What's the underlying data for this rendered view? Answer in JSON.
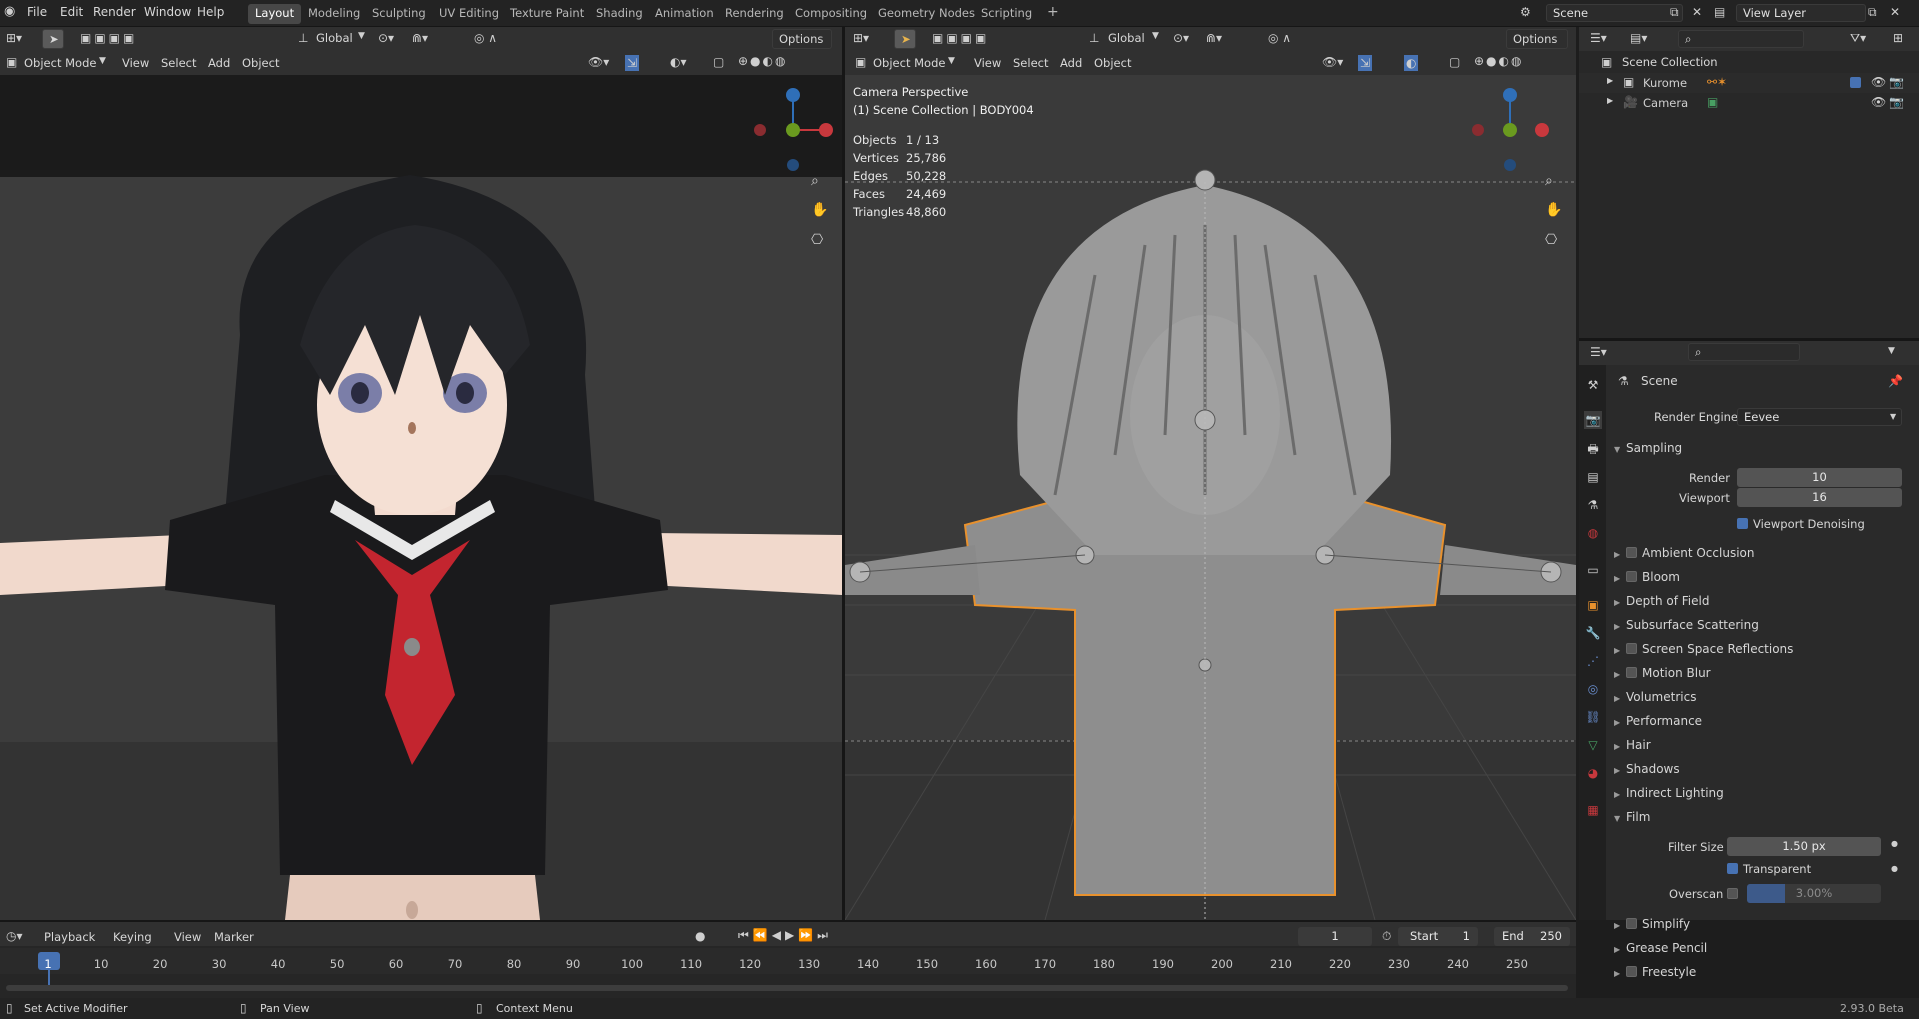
{
  "topbar": {
    "menus": [
      "File",
      "Edit",
      "Render",
      "Window",
      "Help"
    ],
    "workspaces": [
      "Layout",
      "Modeling",
      "Sculpting",
      "UV Editing",
      "Texture Paint",
      "Shading",
      "Animation",
      "Rendering",
      "Compositing",
      "Geometry Nodes",
      "Scripting"
    ],
    "active_workspace": "Layout",
    "add_tab": "+",
    "scene": "Scene",
    "view_layer": "View Layer"
  },
  "left_viewport": {
    "transform_orientation": "Global",
    "options": "Options",
    "mode": "Object Mode",
    "menus": [
      "View",
      "Select",
      "Add",
      "Object"
    ]
  },
  "right_viewport": {
    "transform_orientation": "Global",
    "options": "Options",
    "mode": "Object Mode",
    "menus": [
      "View",
      "Select",
      "Add",
      "Object"
    ],
    "overlay_title": "Camera Perspective",
    "overlay_subtitle": "(1) Scene Collection | BODY004",
    "stats": [
      {
        "label": "Objects",
        "value": "1 / 13"
      },
      {
        "label": "Vertices",
        "value": "25,786"
      },
      {
        "label": "Edges",
        "value": "50,228"
      },
      {
        "label": "Faces",
        "value": "24,469"
      },
      {
        "label": "Triangles",
        "value": "48,860"
      }
    ]
  },
  "outliner": {
    "root": "Scene Collection",
    "items": [
      {
        "name": "Kurome",
        "checked": true
      },
      {
        "name": "Camera",
        "checked": false
      }
    ]
  },
  "properties": {
    "context": "Scene",
    "render_engine_label": "Render Engine",
    "render_engine": "Eevee",
    "sampling": {
      "title": "Sampling",
      "render_label": "Render",
      "render": "10",
      "viewport_label": "Viewport",
      "viewport": "16",
      "denoise": "Viewport Denoising"
    },
    "panels": [
      {
        "name": "Ambient Occlusion",
        "checkbox": true
      },
      {
        "name": "Bloom",
        "checkbox": true
      },
      {
        "name": "Depth of Field",
        "checkbox": false
      },
      {
        "name": "Subsurface Scattering",
        "checkbox": false
      },
      {
        "name": "Screen Space Reflections",
        "checkbox": true
      },
      {
        "name": "Motion Blur",
        "checkbox": true
      },
      {
        "name": "Volumetrics",
        "checkbox": false
      },
      {
        "name": "Performance",
        "checkbox": false
      },
      {
        "name": "Hair",
        "checkbox": false
      },
      {
        "name": "Shadows",
        "checkbox": false
      },
      {
        "name": "Indirect Lighting",
        "checkbox": false
      }
    ],
    "film": {
      "title": "Film",
      "filter_label": "Filter Size",
      "filter": "1.50 px",
      "transparent": "Transparent",
      "overscan_label": "Overscan",
      "overscan": "3.00%"
    },
    "after": [
      {
        "name": "Simplify",
        "checkbox": true
      },
      {
        "name": "Grease Pencil",
        "checkbox": false
      },
      {
        "name": "Freestyle",
        "checkbox": true
      }
    ]
  },
  "timeline": {
    "menus": [
      "Playback",
      "Keying",
      "View",
      "Marker"
    ],
    "current_frame": "1",
    "start_label": "Start",
    "start": "1",
    "end_label": "End",
    "end": "250",
    "ticks": [
      "1",
      "10",
      "20",
      "30",
      "40",
      "50",
      "60",
      "70",
      "80",
      "90",
      "100",
      "110",
      "120",
      "130",
      "140",
      "150",
      "160",
      "170",
      "180",
      "190",
      "200",
      "210",
      "220",
      "230",
      "240",
      "250"
    ]
  },
  "statusbar": {
    "left": "Set Active Modifier",
    "middle": "Pan View",
    "right": "Context Menu",
    "version": "2.93.0 Beta"
  },
  "colors": {
    "accent": "#4772b3",
    "selection_outline": "#e8912d",
    "axis_x": "#c8383d",
    "axis_y": "#6a9a1f",
    "axis_z": "#2f6fb8"
  }
}
